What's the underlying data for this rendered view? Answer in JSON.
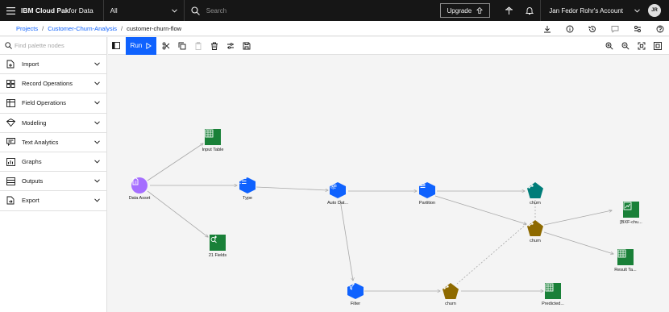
{
  "topbar": {
    "brand_bold": "IBM Cloud Pak",
    "brand_rest": " for Data",
    "scope": "All",
    "search_placeholder": "Search",
    "upgrade": "Upgrade",
    "account": "Jan Fedor Rohr's Account",
    "avatar": "JR"
  },
  "breadcrumb": {
    "projects": "Projects",
    "project": "Customer-Churn-Analysis",
    "flow": "customer-churn-flow"
  },
  "palette": {
    "search_placeholder": "Find palette nodes",
    "categories": [
      {
        "label": "Import",
        "icon": "import-icon"
      },
      {
        "label": "Record Operations",
        "icon": "record-ops-icon"
      },
      {
        "label": "Field Operations",
        "icon": "field-ops-icon"
      },
      {
        "label": "Modeling",
        "icon": "modeling-icon"
      },
      {
        "label": "Text Analytics",
        "icon": "text-analytics-icon"
      },
      {
        "label": "Graphs",
        "icon": "graphs-icon"
      },
      {
        "label": "Outputs",
        "icon": "outputs-icon"
      },
      {
        "label": "Export",
        "icon": "export-icon"
      }
    ]
  },
  "toolbar": {
    "run": "Run"
  },
  "colors": {
    "primary": "#0f62fe",
    "import": "#a56eff",
    "fieldops": "#0f62fe",
    "modeling": "#007d79",
    "model_nugget": "#8e6a00",
    "output": "#198038"
  },
  "flow": {
    "nodes": {
      "data_asset": "Data Asset",
      "input_table": "Input Table",
      "type": "Type",
      "fields": "21 Fields",
      "auto_data": "Auto Dat...",
      "partition": "Partition",
      "churn_model": "churn",
      "churn_nugget": "churn",
      "filter": "Filter",
      "churn_nugget2": "churn",
      "predicted": "Predicted...",
      "bxf": "[BXF-chu...",
      "result": "Result Ta..."
    }
  }
}
